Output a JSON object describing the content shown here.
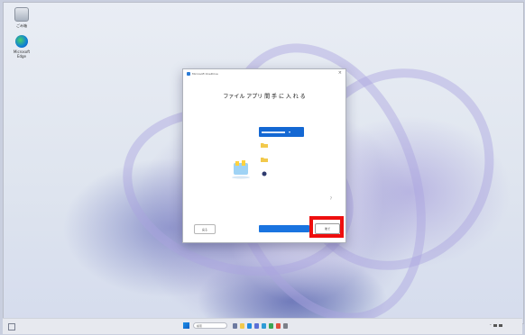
{
  "desktop": {
    "icons": [
      {
        "label": "ごみ箱",
        "icon": "recycle-bin-icon"
      },
      {
        "label": "Microsoft Edge",
        "icon": "edge-icon"
      }
    ]
  },
  "dialog": {
    "app_name": "Microsoft OneDrive",
    "close": "×",
    "title": "ファイル アプリ 間 手 に 入 れ る",
    "description": "",
    "folder_header": "",
    "folders": [
      {
        "label": "",
        "icon": "folder-icon"
      },
      {
        "label": "",
        "icon": "folder-icon"
      },
      {
        "label": "",
        "icon": "device-icon"
      }
    ],
    "help": "?",
    "buttons": {
      "back": "戻る",
      "backup": "",
      "later": "後で"
    }
  },
  "taskbar": {
    "search_placeholder": "検索",
    "apps": [
      "widgets-icon",
      "task-view-icon",
      "explorer-icon",
      "edge-icon",
      "store-icon",
      "mail-icon",
      "photos-icon",
      "chrome-icon",
      "settings-icon"
    ],
    "tray": "^ ",
    "clock": {
      "time": "",
      "date": ""
    }
  },
  "colors": {
    "accent": "#1a74e0",
    "highlight": "#ee0f0f"
  }
}
